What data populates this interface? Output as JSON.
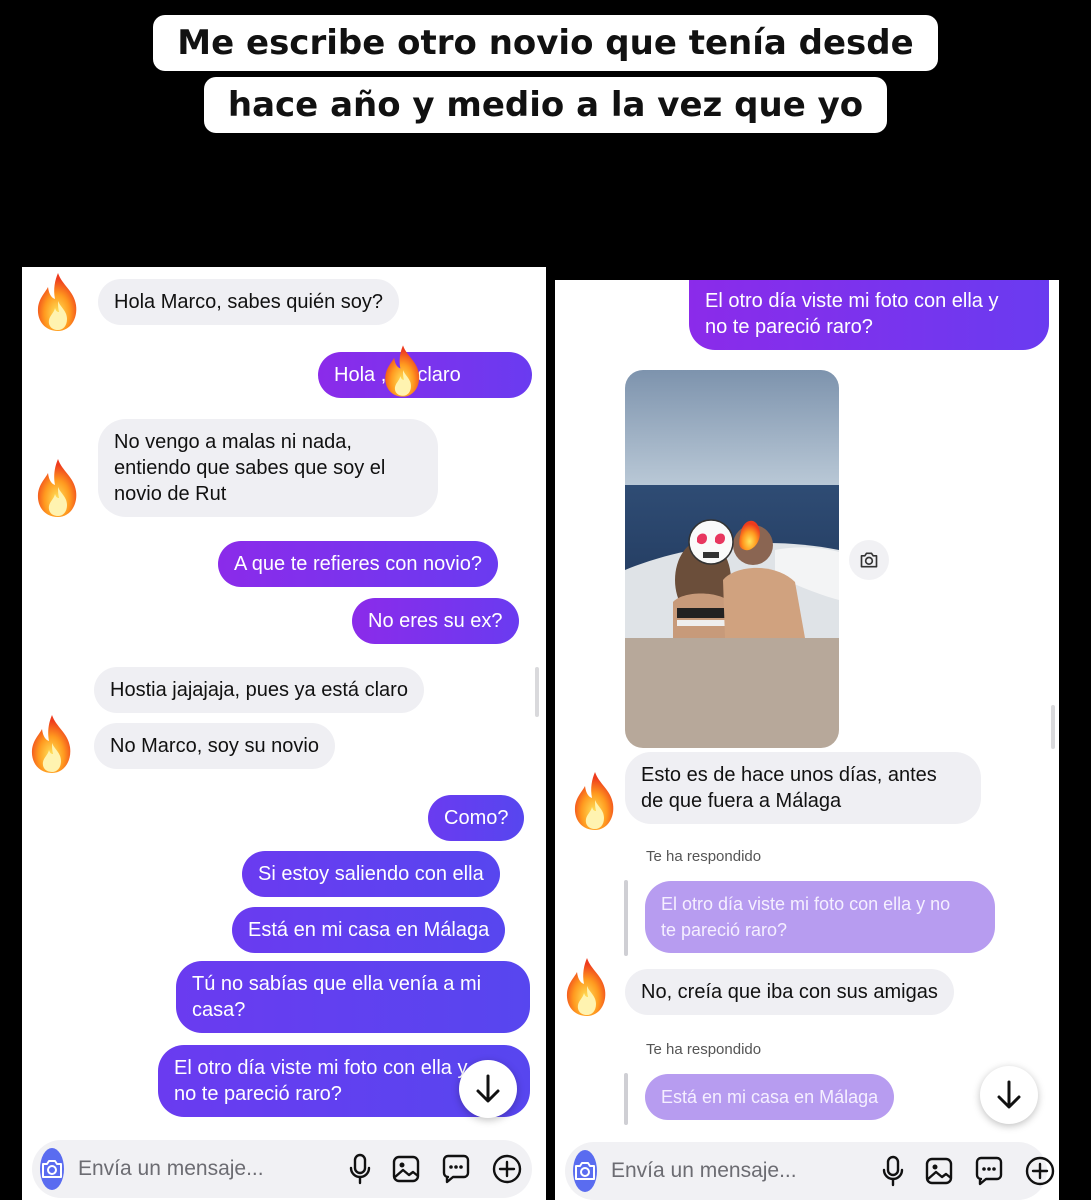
{
  "caption": {
    "line1": "Me escribe otro novio que tenía desde",
    "line2": "hace año y medio a la vez que yo"
  },
  "left_chat": {
    "messages": [
      {
        "side": "in",
        "text": "Hola Marco, sabes quién soy?"
      },
      {
        "side": "out",
        "text": "Hola       , si, claro"
      },
      {
        "side": "in",
        "text": "No vengo a malas ni nada,\nentiendo que sabes que soy el\nnovio de Rut"
      },
      {
        "side": "out",
        "text": "A que te refieres con novio?"
      },
      {
        "side": "out",
        "text": "No eres su ex?"
      },
      {
        "side": "in",
        "text": "Hostia jajajaja, pues ya está claro"
      },
      {
        "side": "in",
        "text": "No Marco, soy su novio"
      },
      {
        "side": "out",
        "text": "Como?"
      },
      {
        "side": "out",
        "text": "Si estoy saliendo con ella"
      },
      {
        "side": "out",
        "text": "Está en mi casa en Málaga"
      },
      {
        "side": "out",
        "text": "Tú no sabías que ella venía a mi\ncasa?"
      },
      {
        "side": "out",
        "text": "El otro día viste mi foto con ella y\nno te pareció raro?"
      }
    ],
    "composer_placeholder": "Envía un mensaje..."
  },
  "right_chat": {
    "top_message": "El otro día viste mi foto con ella y\nno te pareció raro?",
    "incoming_1": "Esto es de hace unos días, antes\nde que fuera a Málaga",
    "reply_label_1": "Te ha respondido",
    "quoted_1": "El otro día viste mi foto con ella y no\nte pareció raro?",
    "incoming_2": "No, creía que iba con sus amigas",
    "reply_label_2": "Te ha respondido",
    "quoted_2": "Está en mi casa en Málaga",
    "composer_placeholder": "Envía un mensaje..."
  },
  "icons": [
    "fire-emoji-icon",
    "camera-icon",
    "microphone-icon",
    "gallery-icon",
    "sticker-icon",
    "plus-circle-icon",
    "arrow-down-icon",
    "skull-heart-eyes-emoji-icon"
  ],
  "colors": {
    "accent_purple": "#8b2bea",
    "accent_blue": "#5a6cf0",
    "bubble_gray": "#efeff3"
  }
}
